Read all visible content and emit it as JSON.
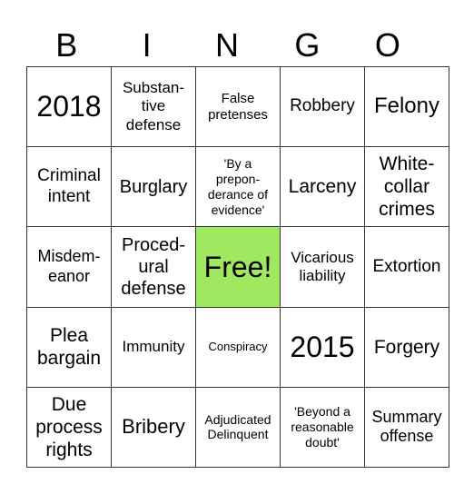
{
  "header": [
    "B",
    "I",
    "N",
    "G",
    "O"
  ],
  "free_color": "#a0e860",
  "cells": [
    [
      "2018",
      "Substan-\ntive\ndefense",
      "False\npretenses",
      "Robbery",
      "Felony"
    ],
    [
      "Criminal\nintent",
      "Burglary",
      "'By a\nprepon-\nderance of\nevidence'",
      "Larceny",
      "White-\ncollar\ncrimes"
    ],
    [
      "Misdem-\neanor",
      "Proced-\nural\ndefense",
      "Free!",
      "Vicarious\nliability",
      "Extortion"
    ],
    [
      "Plea\nbargain",
      "Immunity",
      "Conspiracy",
      "2015",
      "Forgery"
    ],
    [
      "Due\nprocess\nrights",
      "Bribery",
      "Adjudicated\nDelinquent",
      "'Beyond a\nreasonable\ndoubt'",
      "Summary\noffense"
    ]
  ]
}
